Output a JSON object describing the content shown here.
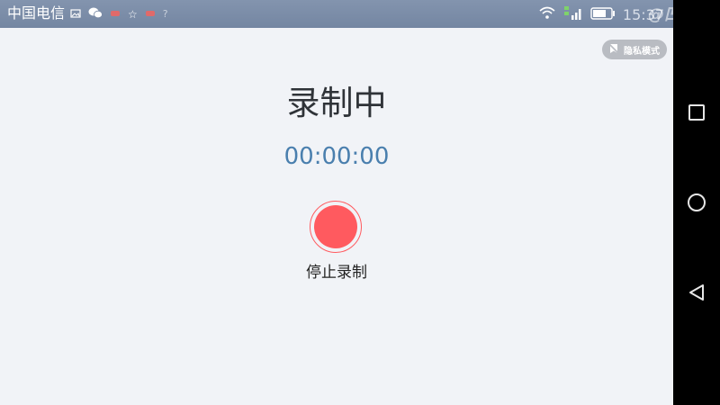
{
  "status_bar": {
    "carrier": "中国电信",
    "time": "15:37",
    "icons_left": [
      "image-icon",
      "wechat-icon",
      "notification-icon",
      "star-icon",
      "notification-icon",
      "help-icon"
    ],
    "icons_right": [
      "wifi-icon",
      "signal-icon",
      "battery-icon"
    ]
  },
  "watermark": "@凹凸手",
  "privacy_toggle": {
    "label": "隐私模式"
  },
  "recording": {
    "title": "录制中",
    "timer": "00:00:00",
    "stop_label": "停止录制",
    "button_color": "#ff5a5f"
  },
  "navigation": {
    "buttons": [
      "recent-apps-button",
      "home-button",
      "back-button"
    ]
  },
  "colors": {
    "status_bar": "#7a8ba6",
    "background": "#f1f3f7",
    "timer_text": "#4a7fae",
    "privacy_badge": "#b9bcc2"
  }
}
